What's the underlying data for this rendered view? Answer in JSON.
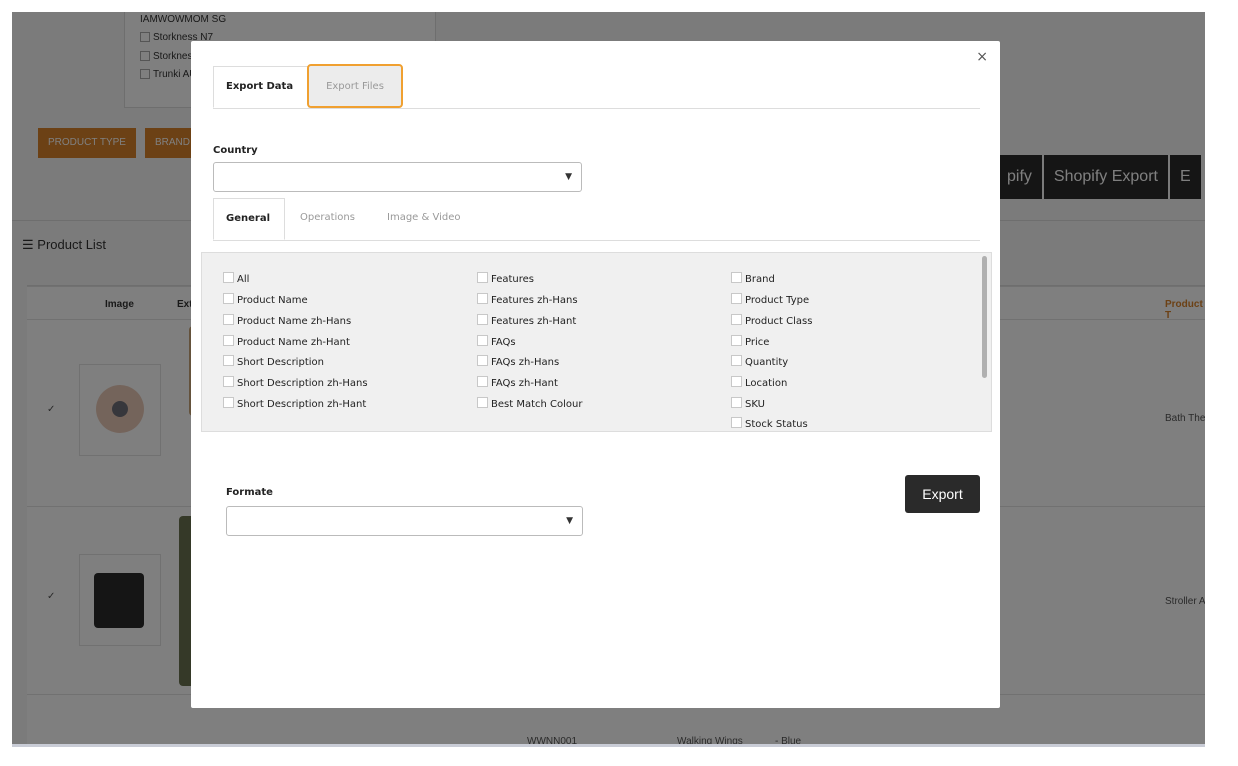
{
  "background": {
    "filter_items": [
      "IAMWOWMOM SG",
      "Storkness N7",
      "Storkness",
      "Trunki AU"
    ],
    "filter_buttons": [
      "PRODUCT TYPE",
      "BRAND"
    ],
    "action_buttons": [
      "pify",
      "Shopify Export",
      "E"
    ],
    "product_list_title": "Product List",
    "table_headers": {
      "image": "Image",
      "extra": "Extr",
      "product_type": "Product T"
    },
    "rows": [
      {
        "check": "✓",
        "product_type": "Bath The"
      },
      {
        "check": "✓",
        "product_type": "Stroller A"
      },
      {
        "sku": "WWNN001",
        "brand": "Walking Wings",
        "variant": "- Blue"
      }
    ]
  },
  "modal": {
    "close": "×",
    "tabs": [
      {
        "label": "Export Data",
        "active": true
      },
      {
        "label": "Export Files",
        "active": false
      }
    ],
    "country_label": "Country",
    "country_value": "",
    "section_tabs": [
      {
        "label": "General",
        "active": true
      },
      {
        "label": "Operations"
      },
      {
        "label": "Image & Video"
      }
    ],
    "fields": {
      "col1": [
        "All",
        "Product Name",
        "Product Name zh-Hans",
        "Product Name zh-Hant",
        "Short Description",
        "Short Description zh-Hans",
        "Short Description zh-Hant"
      ],
      "col2": [
        "Features",
        "Features zh-Hans",
        "Features zh-Hant",
        "FAQs",
        "FAQs zh-Hans",
        "FAQs zh-Hant",
        "Best Match Colour"
      ],
      "col3": [
        "Brand",
        "Product Type",
        "Product Class",
        "Price",
        "Quantity",
        "Location",
        "SKU",
        "Stock Status"
      ]
    },
    "format_label": "Formate",
    "format_value": "",
    "export_button": "Export"
  },
  "colors": {
    "highlight": "#f0a030",
    "export_button": "#2a2a2a",
    "accent_orange": "#d9822b"
  }
}
